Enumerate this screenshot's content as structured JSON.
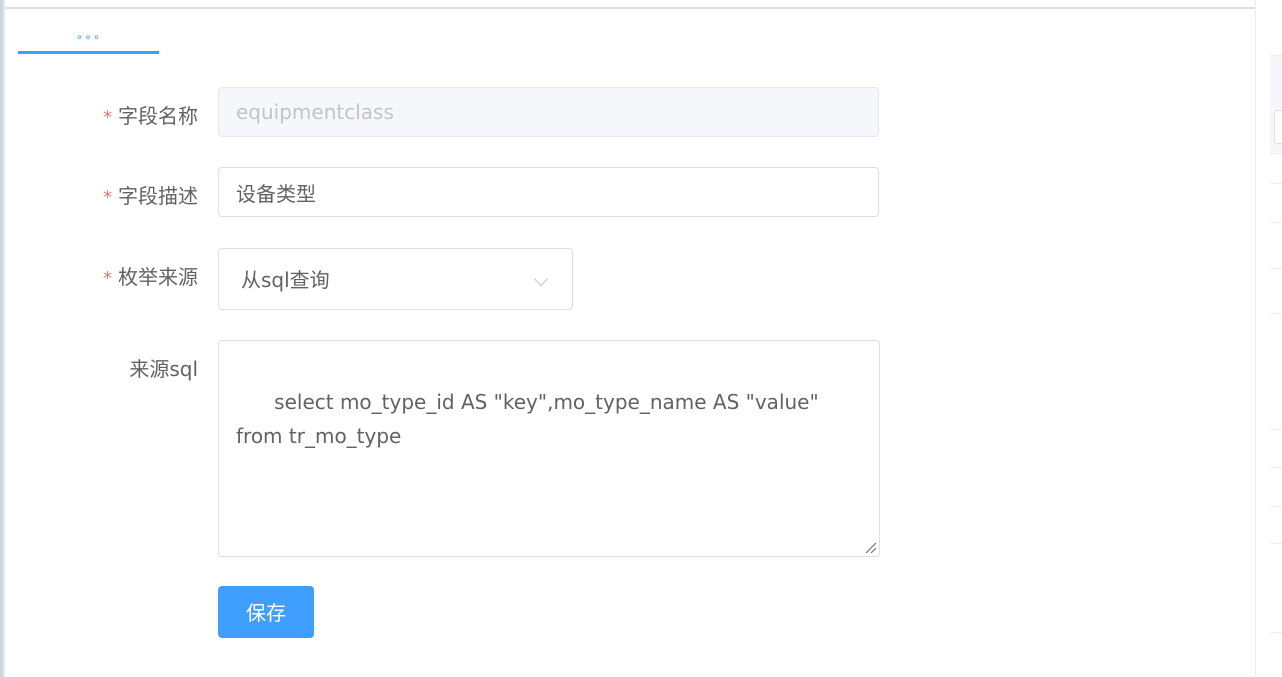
{
  "tab": {
    "label": "∘∘∘",
    "accent_color": "#409eff"
  },
  "form": {
    "field_name": {
      "label": "字段名称",
      "required_mark": "*",
      "value": "equipmentclass",
      "disabled": true
    },
    "field_desc": {
      "label": "字段描述",
      "required_mark": "*",
      "value": "设备类型"
    },
    "enum_source": {
      "label": "枚举来源",
      "required_mark": "*",
      "value": "从sql查询",
      "icon": "chevron-down-icon"
    },
    "source_sql": {
      "label": "来源sql",
      "value": "select mo_type_id AS \"key\",mo_type_name AS \"value\"\nfrom tr_mo_type"
    },
    "save_label": "保存"
  },
  "colors": {
    "primary": "#409eff",
    "required": "#f56c6c",
    "text": "#606266",
    "disabled_bg": "#f5f7fa",
    "disabled_text": "#c0c4cc"
  }
}
